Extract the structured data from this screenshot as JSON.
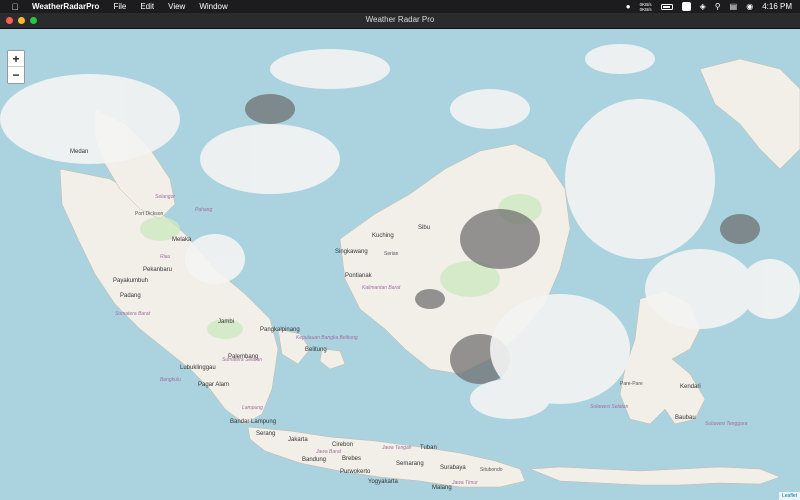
{
  "menubar": {
    "app_name": "WeatherRadarPro",
    "items": [
      "File",
      "Edit",
      "View",
      "Window"
    ],
    "net_up": "0KB/s",
    "net_down": "0KB/s",
    "clock": "4:16 PM"
  },
  "window": {
    "title": "Weather Radar Pro"
  },
  "map": {
    "zoom_in": "+",
    "zoom_out": "−",
    "attribution": "Leaflet",
    "labels": {
      "padang": "Padang",
      "payakumbuh": "Payakumbuh",
      "pekanbaru": "Pekanbaru",
      "riau": "Riau",
      "jambi": "Jambi",
      "pangkalpinang": "Pangkalpinang",
      "palembang": "Palembang",
      "sumatera_selatan": "Sumatera Selatan",
      "sumatera_barat": "Sumatera Barat",
      "lubuklinggau": "Lubuklinggau",
      "bengkulu": "Bengkulu",
      "pagar_alam": "Pagar Alam",
      "lampung": "Lampung",
      "bandar_lampung": "Bandar Lampung",
      "serang": "Serang",
      "jakarta": "Jakarta",
      "bandung": "Bandung",
      "cirebon": "Cirebon",
      "brebes": "Brebes",
      "purwokerto": "Purwokerto",
      "semarang": "Semarang",
      "yogyakarta": "Yogyakarta",
      "tuban": "Tuban",
      "surabaya": "Surabaya",
      "situbondo": "Situbondo",
      "malang": "Malang",
      "jawa_barat": "Jawa Barat",
      "jawa_tengah": "Jawa Tengah",
      "jawa_timur": "Jawa Timur",
      "kuching": "Kuching",
      "sibu": "Sibu",
      "singkawang": "Singkawang",
      "serian": "Serian",
      "pontianak": "Pontianak",
      "kalimantan_barat": "Kalimantan Barat",
      "kepulauan_bangka_belitung": "Kepulauan Bangka Belitung",
      "belitung": "Belitung",
      "kendari": "Kendari",
      "baubau": "Baubau",
      "pare_pare": "Pare-Pare",
      "sulawesi_selatan": "Sulawesi Selatan",
      "sulawesi_tenggara": "Sulawesi Tenggara",
      "melaka": "Melaka",
      "port_dickson": "Port Dickson",
      "selangor": "Selangor",
      "pahang": "Pahang",
      "medan": "Medan"
    }
  }
}
